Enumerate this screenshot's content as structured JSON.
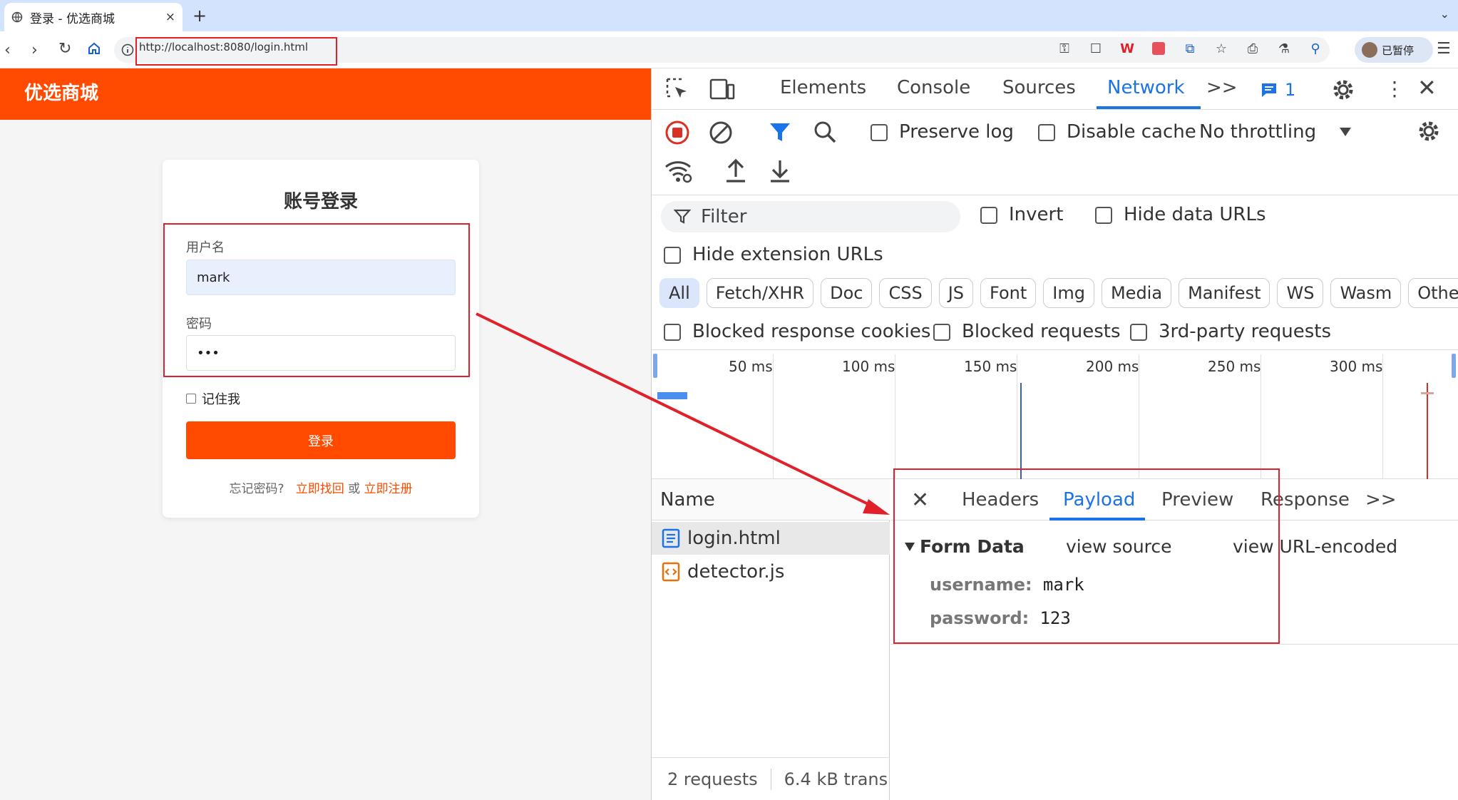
{
  "browser": {
    "tab_title": "登录 - 优选商城",
    "tab_close": "×",
    "new_tab": "+",
    "tab_menu": "⌄",
    "url": "http://localhost:8080/login.html",
    "paused_label": "已暂停"
  },
  "page": {
    "brand": "优选商城",
    "card_title": "账号登录",
    "username_label": "用户名",
    "username_value": "mark",
    "password_label": "密码",
    "password_value": "•••",
    "remember_label": "记住我",
    "login_button": "登录",
    "forgot_text": "忘记密码?",
    "recover_link": "立即找回",
    "or_text": "或",
    "register_link": "立即注册"
  },
  "devtools": {
    "tabs": [
      "Elements",
      "Console",
      "Sources",
      "Network"
    ],
    "more": ">>",
    "issues_count": "1",
    "preserve_log": "Preserve log",
    "disable_cache": "Disable cache",
    "throttling": "No throttling",
    "filter_placeholder": "Filter",
    "invert": "Invert",
    "hide_data_urls": "Hide data URLs",
    "hide_extension_urls": "Hide extension URLs",
    "chips": [
      "All",
      "Fetch/XHR",
      "Doc",
      "CSS",
      "JS",
      "Font",
      "Img",
      "Media",
      "Manifest",
      "WS",
      "Wasm",
      "Other"
    ],
    "blocked_cookies": "Blocked response cookies",
    "blocked_requests": "Blocked requests",
    "third_party": "3rd-party requests",
    "ticks": [
      "50 ms",
      "100 ms",
      "150 ms",
      "200 ms",
      "250 ms",
      "300 ms"
    ],
    "name_header": "Name",
    "requests": [
      "login.html",
      "detector.js"
    ],
    "status_requests": "2 requests",
    "status_transfer": "6.4 kB trans",
    "panel_tabs": [
      "Headers",
      "Payload",
      "Preview",
      "Response"
    ],
    "panel_more": ">>",
    "form_data_title": "Form Data",
    "view_source": "view source",
    "view_url_encoded": "view URL-encoded",
    "fields": [
      {
        "key": "username:",
        "value": "mark"
      },
      {
        "key": "password:",
        "value": "123"
      }
    ]
  },
  "colors": {
    "brand": "#ff4a00",
    "annotation": "#e0202a",
    "devtools_accent": "#1a73e8"
  }
}
